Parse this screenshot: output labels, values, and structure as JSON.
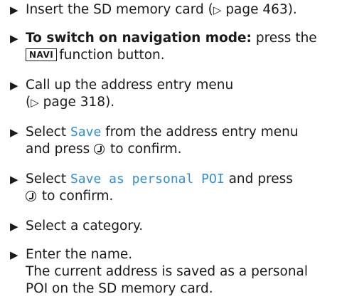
{
  "marker": "▶",
  "page_ref_arrow": "▷",
  "steps": [
    {
      "text_before": "Insert the SD memory card (",
      "ref": "page 463",
      "text_after": ")."
    },
    {
      "bold": "To switch on navigation mode:",
      "text": " press the",
      "key": "NAVI",
      "text2": "function button."
    },
    {
      "text": "Call up the address entry menu",
      "ref_open": "(",
      "ref": "page 318",
      "ref_close": ")."
    },
    {
      "text_before": "Select ",
      "screen": "Save",
      "text_after": " from the address entry menu",
      "line2_before": "and press ",
      "line2_after": " to confirm."
    },
    {
      "text_before": "Select ",
      "screen": "Save as personal POI",
      "text_after": " and press",
      "line2_after": " to confirm."
    },
    {
      "text": "Select a category."
    },
    {
      "text": "Enter the name.",
      "line2": "The current address is saved as a personal",
      "line3": "POI on the SD memory card."
    }
  ]
}
